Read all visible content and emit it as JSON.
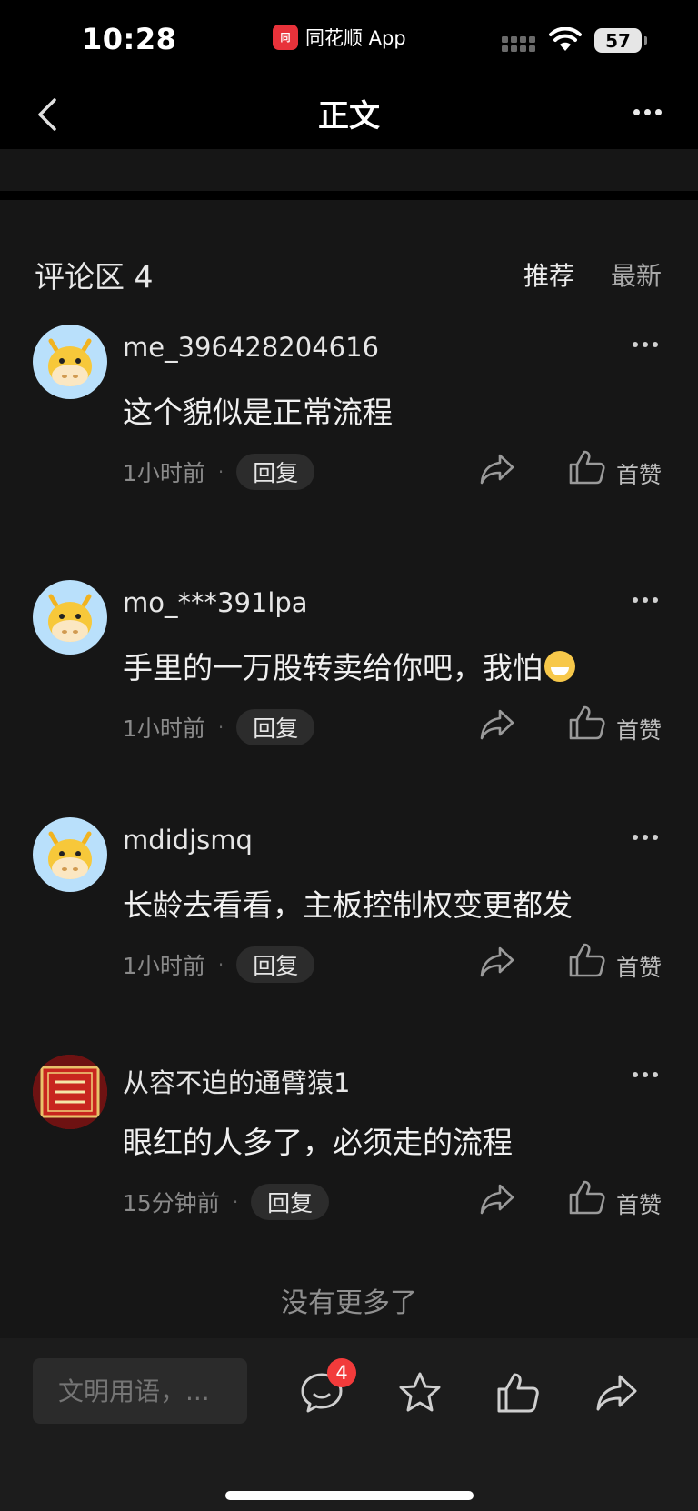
{
  "status_bar": {
    "time": "10:28",
    "app_name": "同花顺 App",
    "app_logo_text": "同",
    "battery": "57"
  },
  "navbar": {
    "title": "正文"
  },
  "comments": {
    "header_label": "评论区",
    "count": "4",
    "sort_recommended": "推荐",
    "sort_latest": "最新",
    "reply_label": "回复",
    "like_label": "首赞",
    "items": [
      {
        "username": "me_396428204616",
        "text": "这个貌似是正常流程",
        "time": "1小时前"
      },
      {
        "username": "mo_***391lpa",
        "text": "手里的一万股转卖给你吧，我怕",
        "time": "1小时前"
      },
      {
        "username": "mdidjsmq",
        "text": "长龄去看看，主板控制权变更都发",
        "time": "1小时前"
      },
      {
        "username": "从容不迫的通臂猿1",
        "text": "眼红的人多了，必须走的流程",
        "time": "15分钟前"
      }
    ],
    "no_more": "没有更多了"
  },
  "bottom_bar": {
    "input_placeholder": "文明用语，...",
    "comment_badge": "4"
  },
  "colors": {
    "background": "#161616",
    "accent_red": "#f23b3b",
    "avatar_bg": "#b9e0fb"
  }
}
